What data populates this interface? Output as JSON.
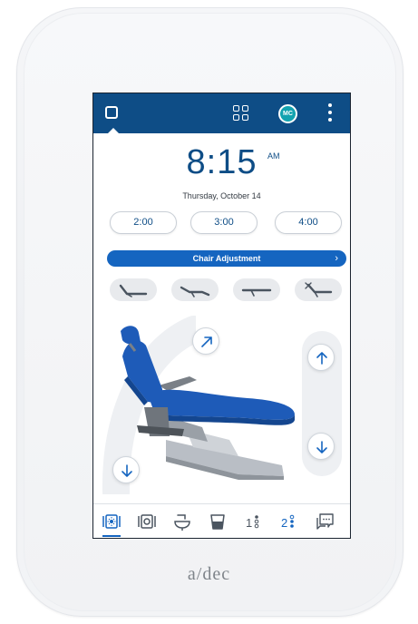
{
  "brand": {
    "logo_text": "a/dec"
  },
  "topbar": {
    "home_icon": "home-square-icon",
    "apps_icon": "grid-icon",
    "user_initials": "MC",
    "menu_icon": "kebab-menu-icon"
  },
  "clock": {
    "time": "8:15",
    "ampm": "AM",
    "date": "Thursday, October 14"
  },
  "timers": [
    {
      "label": "2:00"
    },
    {
      "label": "3:00"
    },
    {
      "label": "4:00"
    }
  ],
  "chair_adjustment": {
    "label": "Chair Adjustment",
    "chevron": "›"
  },
  "presets": [
    {
      "icon": "chair-entry-position-icon"
    },
    {
      "icon": "chair-reclined-position-icon"
    },
    {
      "icon": "chair-flat-position-icon"
    },
    {
      "icon": "chair-x-ray-position-icon"
    }
  ],
  "controls": {
    "backrest_up": "arrow-up-right-icon",
    "base_down": "arrow-down-icon",
    "chair_up": "arrow-up-icon",
    "chair_down": "arrow-down-icon"
  },
  "bottom_nav": [
    {
      "icon": "operatory-light-icon",
      "active": true
    },
    {
      "icon": "camera-monitor-icon",
      "active": false
    },
    {
      "icon": "cuspidor-icon",
      "active": false
    },
    {
      "icon": "cup-fill-icon",
      "active": false
    },
    {
      "icon": "preset-1-icon",
      "active": false
    },
    {
      "icon": "preset-2-icon",
      "active": false
    },
    {
      "icon": "messages-icon",
      "active": false
    }
  ],
  "colors": {
    "brand_blue": "#0e4d86",
    "accent_blue": "#1565c0",
    "avatar_teal": "#13a3b0",
    "chair_upholstery": "#1e5bb8"
  }
}
